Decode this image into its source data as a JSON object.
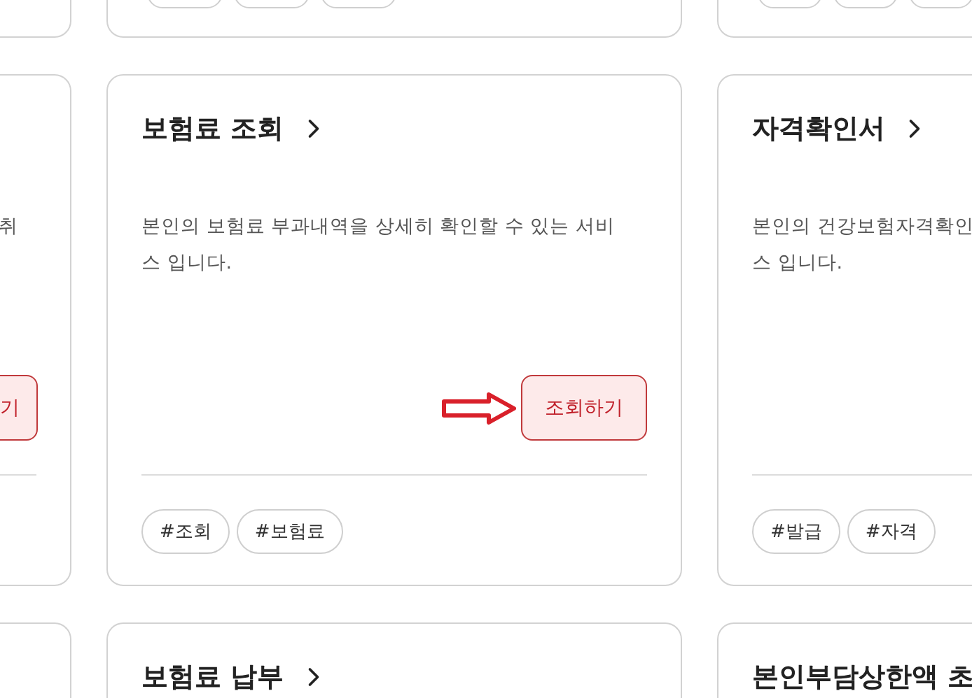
{
  "cards": [
    {
      "kind": "left",
      "description_lines": [
        "취"
      ],
      "button": "기"
    },
    {
      "kind": "center",
      "title": "보험료 조회",
      "description_lines": [
        "본인의 보험료 부과내역을 상세히 확인할 수 있는 서비",
        "스 입니다."
      ],
      "button": "조회하기",
      "tags": [
        "#조회",
        "#보험료"
      ]
    },
    {
      "kind": "right",
      "title": "자격확인서",
      "description_lines": [
        "본인의 건강보험자격확인",
        "스 입니다."
      ],
      "tags": [
        "#발급",
        "#자격"
      ]
    }
  ],
  "next_row": [
    {
      "kind": "center",
      "title": "보험료 납부"
    },
    {
      "kind": "right",
      "title": "본인부담상한액 초"
    }
  ]
}
